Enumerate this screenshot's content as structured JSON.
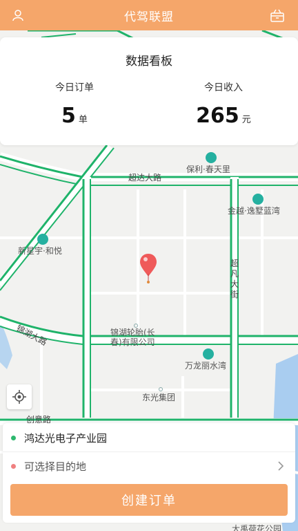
{
  "header": {
    "title": "代驾联盟",
    "left_icon": "user-icon",
    "right_icon": "gift-box-icon"
  },
  "dashboard": {
    "title": "数据看板",
    "orders": {
      "label": "今日订单",
      "value": "5",
      "unit": "单"
    },
    "income": {
      "label": "今日收入",
      "value": "265",
      "unit": "元"
    }
  },
  "map": {
    "roads": [
      "超达大路",
      "锦湖大路",
      "超凡大街",
      "创意路"
    ],
    "pois": [
      "保利·春天里",
      "金越·逸墅蓝湾",
      "新星宇·和悦",
      "锦湖轮胎(长春)有限公司",
      "万龙丽水湾",
      "东光集团",
      "大禹荷花公园"
    ],
    "route_color": "#1fb36a",
    "pin_color": "#ef5a5a"
  },
  "order": {
    "from": "鸿达光电子产业园",
    "to_placeholder": "可选择目的地",
    "create_label": "创建订单",
    "from_dot_color": "#2db86e",
    "to_dot_color": "#f08080"
  }
}
